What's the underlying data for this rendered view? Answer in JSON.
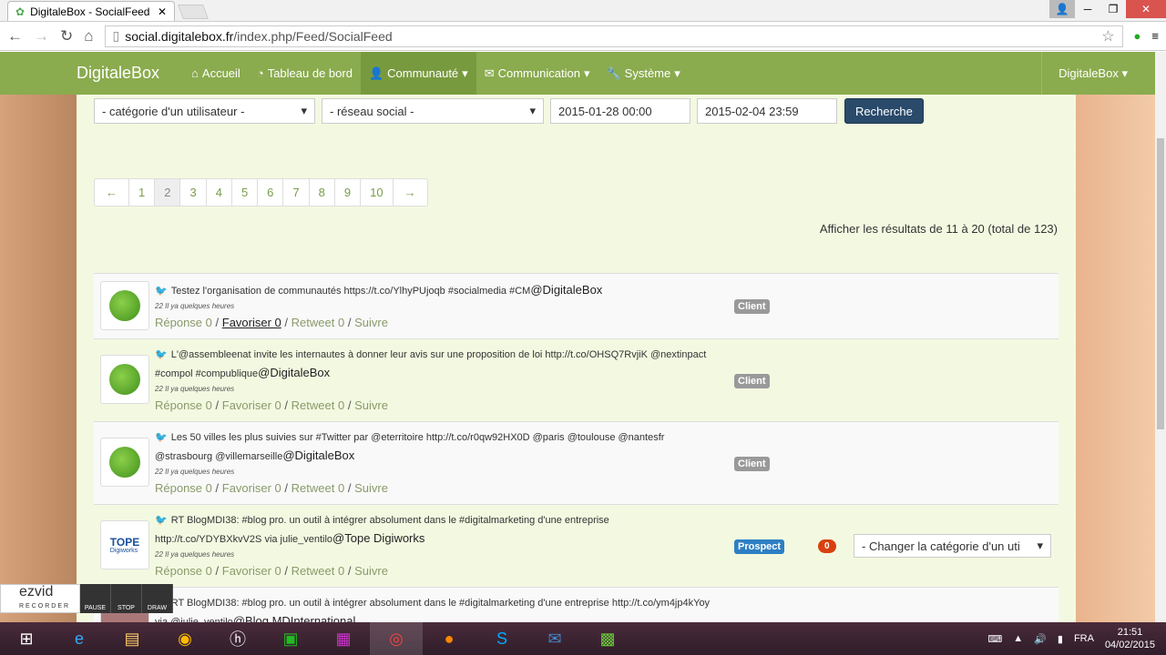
{
  "browser": {
    "tab_title": "DigitaleBox - SocialFeed F",
    "url_host": "social.digitalebox.fr",
    "url_path": "/index.php/Feed/SocialFeed"
  },
  "navbar": {
    "brand": "DigitaleBox",
    "items": [
      {
        "label": "Accueil",
        "icon": "home-icon"
      },
      {
        "label": "Tableau de bord",
        "icon": "dashboard-icon"
      },
      {
        "label": "Communauté",
        "icon": "users-icon"
      },
      {
        "label": "Communication",
        "icon": "envelope-icon"
      },
      {
        "label": "Système",
        "icon": "wrench-icon"
      }
    ],
    "right": "DigitaleBox"
  },
  "filters": {
    "category": "- catégorie d'un utilisateur -",
    "network": "- réseau social -",
    "date_from": "2015-01-28 00:00",
    "date_to": "2015-02-04 23:59",
    "search": "Recherche"
  },
  "pager": {
    "prev": "←",
    "pages": [
      "1",
      "2",
      "3",
      "4",
      "5",
      "6",
      "7",
      "8",
      "9",
      "10"
    ],
    "next": "→",
    "current": "2"
  },
  "results": "Afficher les résultats de 11 à 20 (total de 123)",
  "feed": [
    {
      "text": "Testez l'organisation de communautés https://t.co/YlhyPUjoqb #socialmedia #CM",
      "handle": "@DigitaleBox",
      "time": "22 Il ya quelques heures",
      "badge": "Client"
    },
    {
      "text": "L'@assembleenat invite les internautes à donner leur avis sur une proposition de loi http://t.co/OHSQ7RvjiK @nextinpact #compol #compublique",
      "handle": "@DigitaleBox",
      "time": "22 Il ya quelques heures",
      "badge": "Client"
    },
    {
      "text": "Les 50 villes les plus suivies sur #Twitter par @eterritoire http://t.co/r0qw92HX0D @paris @toulouse @nantesfr @strasbourg @villemarseille",
      "handle": "@DigitaleBox",
      "time": "22 Il ya quelques heures",
      "badge": "Client"
    },
    {
      "text": "RT BlogMDI38: #blog pro. un outil à intégrer absolument dans le #digitalmarketing d'une entreprise http://t.co/YDYBXkvV2S via julie_ventilo",
      "handle": "@Tope Digiworks",
      "time": "22 Il ya quelques heures",
      "badge": "Prospect",
      "count": "0",
      "category_select": "- Changer la catégorie d'un uti",
      "avatar_text": "TOPE",
      "avatar_sub": "Digiworks"
    },
    {
      "text": "RT BlogMDI38: #blog pro. un outil à intégrer absolument dans le #digitalmarketing d'une entreprise http://t.co/ym4jp4kYoy via @julie_ventilo",
      "handle": "@Blog MDInternational"
    }
  ],
  "actions": {
    "reply": "Réponse 0",
    "fav": "Favoriser 0",
    "retweet": "Retweet 0",
    "follow": "Suivre",
    "sep": "/"
  },
  "ezvid": {
    "logo": "ezvid",
    "sub": "RECORDER",
    "pause": "PAUSE",
    "stop": "STOP",
    "draw": "DRAW"
  },
  "taskbar": {
    "lang": "FRA",
    "time": "21:51",
    "date": "04/02/2015"
  }
}
